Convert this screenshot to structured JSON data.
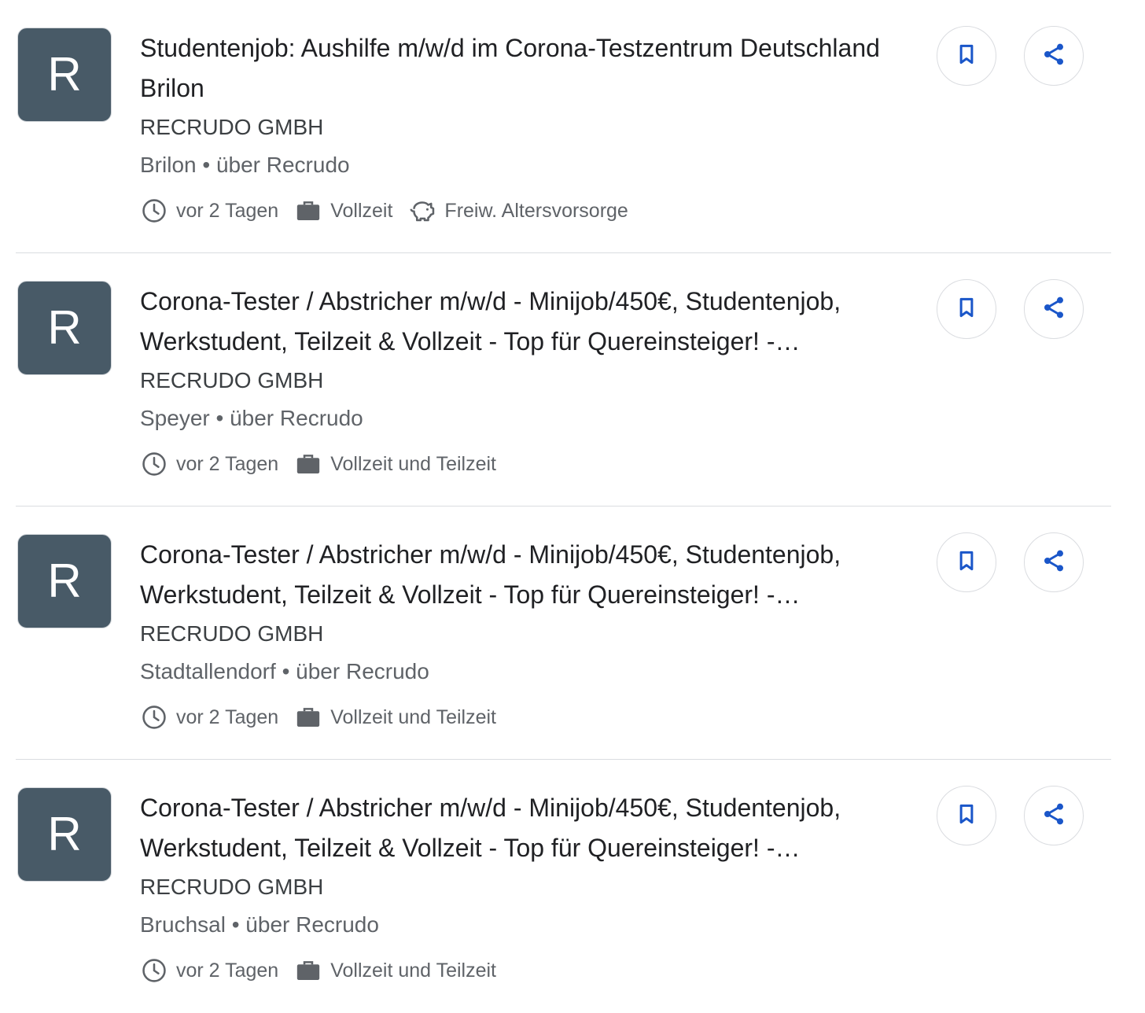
{
  "colors": {
    "logo_bg": "#485a67",
    "accent_blue": "#1a56c9",
    "divider": "#dadce0"
  },
  "icons": {
    "time": "clock-icon",
    "type": "briefcase-icon",
    "benefit": "piggy-bank-icon",
    "save": "bookmark-icon",
    "share": "share-icon"
  },
  "jobs": [
    {
      "logo_letter": "R",
      "title": "Studentenjob: Aushilfe m/w/d im Corona-Testzentrum Deutschland Brilon",
      "company": "RECRUDO GMBH",
      "location": "Brilon • über Recrudo",
      "posted": "vor 2 Tagen",
      "employment_type": "Vollzeit",
      "benefit": "Freiw. Altersvorsorge"
    },
    {
      "logo_letter": "R",
      "title": "Corona-Tester / Abstricher m/w/d - Minijob/450€, Studentenjob, Werkstudent, Teilzeit & Vollzeit - Top für Quereinsteiger! -…",
      "company": "RECRUDO GMBH",
      "location": "Speyer • über Recrudo",
      "posted": "vor 2 Tagen",
      "employment_type": "Vollzeit und Teilzeit"
    },
    {
      "logo_letter": "R",
      "title": "Corona-Tester / Abstricher m/w/d - Minijob/450€, Studentenjob, Werkstudent, Teilzeit & Vollzeit - Top für Quereinsteiger! -…",
      "company": "RECRUDO GMBH",
      "location": "Stadtallendorf • über Recrudo",
      "posted": "vor 2 Tagen",
      "employment_type": "Vollzeit und Teilzeit"
    },
    {
      "logo_letter": "R",
      "title": "Corona-Tester / Abstricher m/w/d - Minijob/450€, Studentenjob, Werkstudent, Teilzeit & Vollzeit - Top für Quereinsteiger! -…",
      "company": "RECRUDO GMBH",
      "location": "Bruchsal • über Recrudo",
      "posted": "vor 2 Tagen",
      "employment_type": "Vollzeit und Teilzeit"
    }
  ]
}
